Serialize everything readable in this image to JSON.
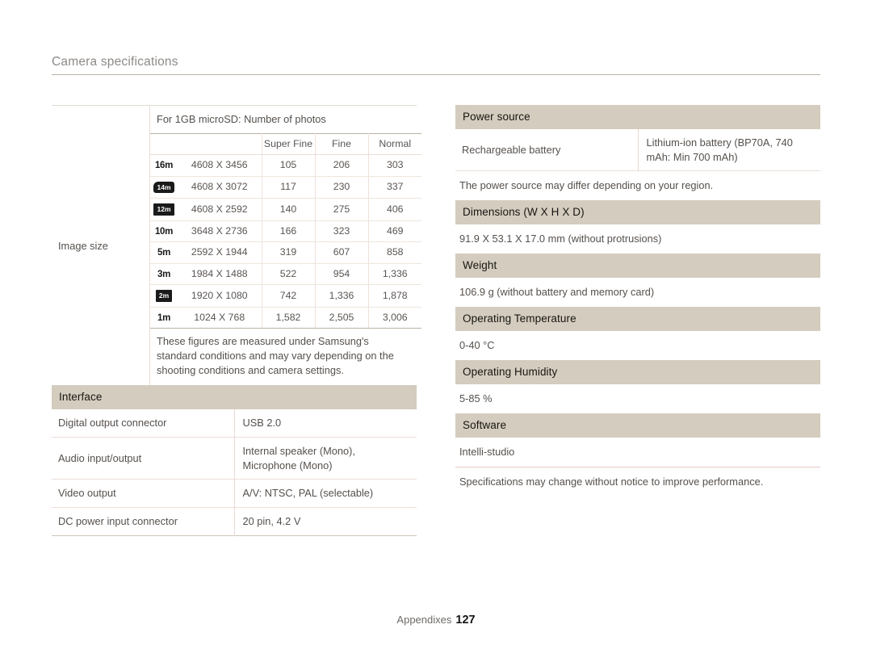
{
  "page": {
    "title": "Camera specifications",
    "footer_label": "Appendixes",
    "footer_page": "127"
  },
  "left": {
    "image_size": {
      "label": "Image size",
      "microsd_heading": "For 1GB microSD: Number of photos",
      "columns": [
        "",
        "",
        "Super Fine",
        "Fine",
        "Normal"
      ],
      "rows": [
        {
          "icon": "16m",
          "icon_style": "text",
          "resolution": "4608 X 3456",
          "super_fine": "105",
          "fine": "206",
          "normal": "303"
        },
        {
          "icon": "14m",
          "icon_style": "frame-rounded",
          "resolution": "4608 X 3072",
          "super_fine": "117",
          "fine": "230",
          "normal": "337"
        },
        {
          "icon": "12m",
          "icon_style": "frame",
          "resolution": "4608 X 2592",
          "super_fine": "140",
          "fine": "275",
          "normal": "406"
        },
        {
          "icon": "10m",
          "icon_style": "text",
          "resolution": "3648 X 2736",
          "super_fine": "166",
          "fine": "323",
          "normal": "469"
        },
        {
          "icon": "5m",
          "icon_style": "text",
          "resolution": "2592 X 1944",
          "super_fine": "319",
          "fine": "607",
          "normal": "858"
        },
        {
          "icon": "3m",
          "icon_style": "text",
          "resolution": "1984 X 1488",
          "super_fine": "522",
          "fine": "954",
          "normal": "1,336"
        },
        {
          "icon": "2m",
          "icon_style": "frame",
          "resolution": "1920 X 1080",
          "super_fine": "742",
          "fine": "1,336",
          "normal": "1,878"
        },
        {
          "icon": "1m",
          "icon_style": "text",
          "resolution": "1024 X 768",
          "super_fine": "1,582",
          "fine": "2,505",
          "normal": "3,006"
        }
      ],
      "footnote": "These figures are measured under Samsung's standard conditions and may vary depending on the shooting conditions and camera settings."
    },
    "interface": {
      "heading": "Interface",
      "rows": [
        {
          "label": "Digital output connector",
          "value": "USB 2.0"
        },
        {
          "label": "Audio input/output",
          "value": "Internal speaker (Mono), Microphone (Mono)"
        },
        {
          "label": "Video output",
          "value": "A/V: NTSC, PAL (selectable)"
        },
        {
          "label": "DC power input connector",
          "value": "20 pin, 4.2 V"
        }
      ]
    }
  },
  "right": {
    "power_source": {
      "heading": "Power source",
      "row_label": "Rechargeable battery",
      "row_value": "Lithium-ion battery (BP70A, 740 mAh: Min 700 mAh)",
      "note": "The power source may differ depending on your region."
    },
    "dimensions": {
      "heading": "Dimensions (W X H X D)",
      "value": "91.9 X 53.1 X 17.0 mm (without protrusions)"
    },
    "weight": {
      "heading": "Weight",
      "value": "106.9 g (without battery and memory card)"
    },
    "operating_temperature": {
      "heading": "Operating Temperature",
      "value": "0-40 °C"
    },
    "operating_humidity": {
      "heading": "Operating Humidity",
      "value": "5-85 %"
    },
    "software": {
      "heading": "Software",
      "value": "Intelli-studio"
    },
    "final_note": "Specifications may change without notice to improve performance."
  },
  "colors": {
    "section_header_bg": "#d4ccbe",
    "rule": "#b9b3a5",
    "text": "#55504c"
  }
}
